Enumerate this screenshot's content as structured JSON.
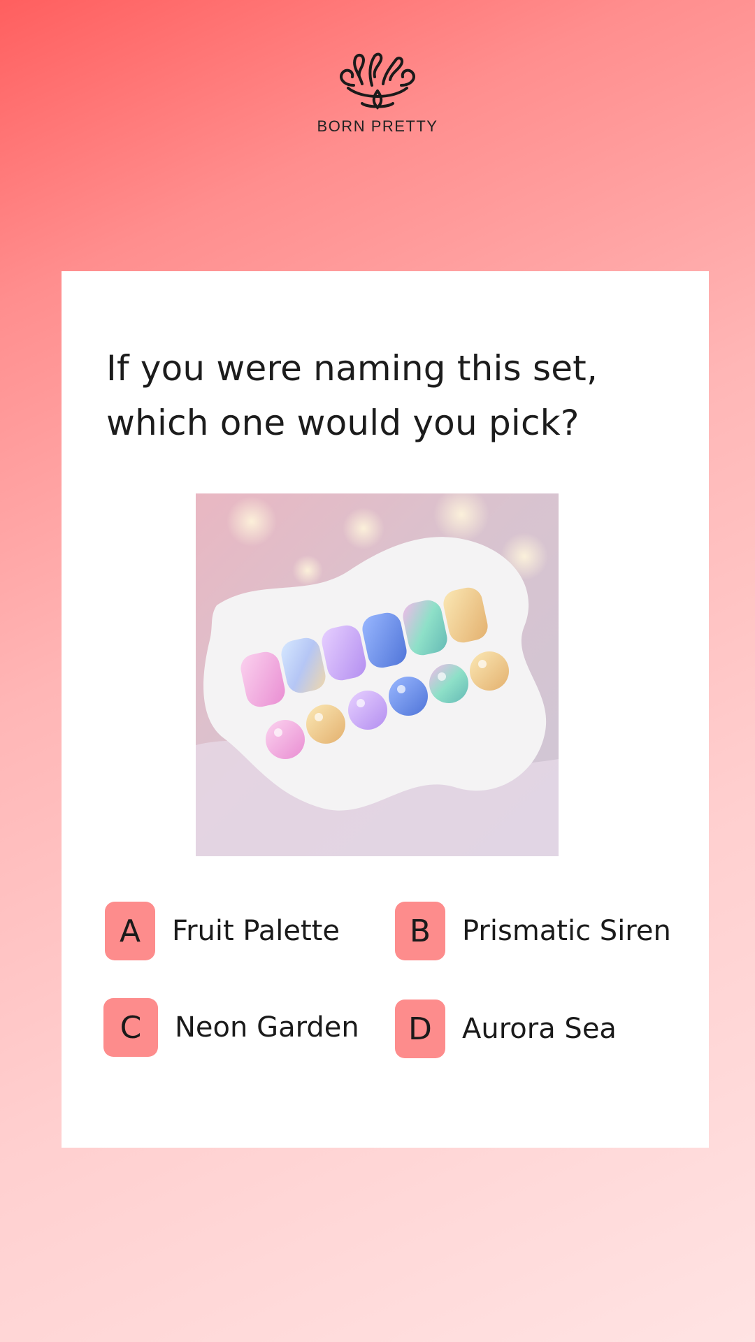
{
  "brand": {
    "name": "BORN PRETTY",
    "logo_icon": "swirl-logo-icon"
  },
  "quiz": {
    "question": "If you were naming this set, which one would you pick?",
    "image": {
      "icon": "nail-swatch-photo",
      "alt": "nail swatch display with six pastel nail tips and six gel drops"
    },
    "options": [
      {
        "letter": "A",
        "label": "Fruit Palette"
      },
      {
        "letter": "B",
        "label": "Prismatic Siren"
      },
      {
        "letter": "C",
        "label": "Neon Garden"
      },
      {
        "letter": "D",
        "label": "Aurora Sea"
      }
    ]
  },
  "colors": {
    "badge": "#fd8c8c",
    "card": "#ffffff",
    "background_top": "#ff5f5f",
    "background_bottom": "#ffe3e3"
  }
}
